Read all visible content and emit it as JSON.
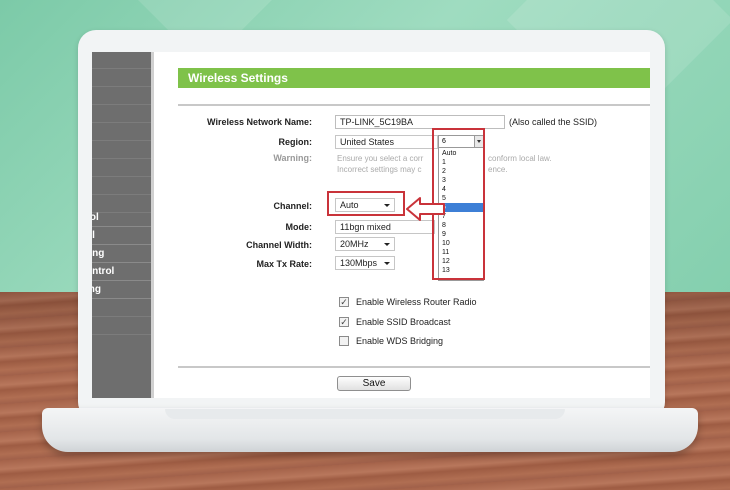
{
  "sidebar": {
    "items": [
      {
        "label": "rol"
      },
      {
        "label": "ol"
      },
      {
        "label": "ting"
      },
      {
        "label": "ontrol"
      },
      {
        "label": "ing"
      }
    ]
  },
  "header": {
    "title": "Wireless Settings"
  },
  "form": {
    "network_name": {
      "label": "Wireless Network Name:",
      "value": "TP-LINK_5C19BA",
      "note": "(Also called the SSID)"
    },
    "region": {
      "label": "Region:",
      "value": "United States"
    },
    "warning": {
      "label": "Warning:",
      "line1": "Ensure you select a corr",
      "line1_end": "conform local law.",
      "line2": "Incorrect settings may c",
      "line2_end": "ence."
    },
    "channel": {
      "label": "Channel:",
      "value": "Auto"
    },
    "mode": {
      "label": "Mode:",
      "value": "11bgn mixed"
    },
    "channel_width": {
      "label": "Channel Width:",
      "value": "20MHz"
    },
    "max_tx_rate": {
      "label": "Max Tx Rate:",
      "value": "130Mbps"
    }
  },
  "channel_dropdown": {
    "selected": "6",
    "highlighted": "6",
    "options": [
      "Auto",
      "1",
      "2",
      "3",
      "4",
      "5",
      "6",
      "7",
      "8",
      "9",
      "10",
      "11",
      "12",
      "13"
    ]
  },
  "checkboxes": [
    {
      "label": "Enable Wireless Router Radio",
      "checked": true
    },
    {
      "label": "Enable SSID Broadcast",
      "checked": true
    },
    {
      "label": "Enable WDS Bridging",
      "checked": false
    }
  ],
  "save_label": "Save",
  "colors": {
    "header": "#7fc24a",
    "highlight": "#c9333a",
    "sidebar": "#6e6e6e",
    "selection": "#3d7fd6"
  }
}
